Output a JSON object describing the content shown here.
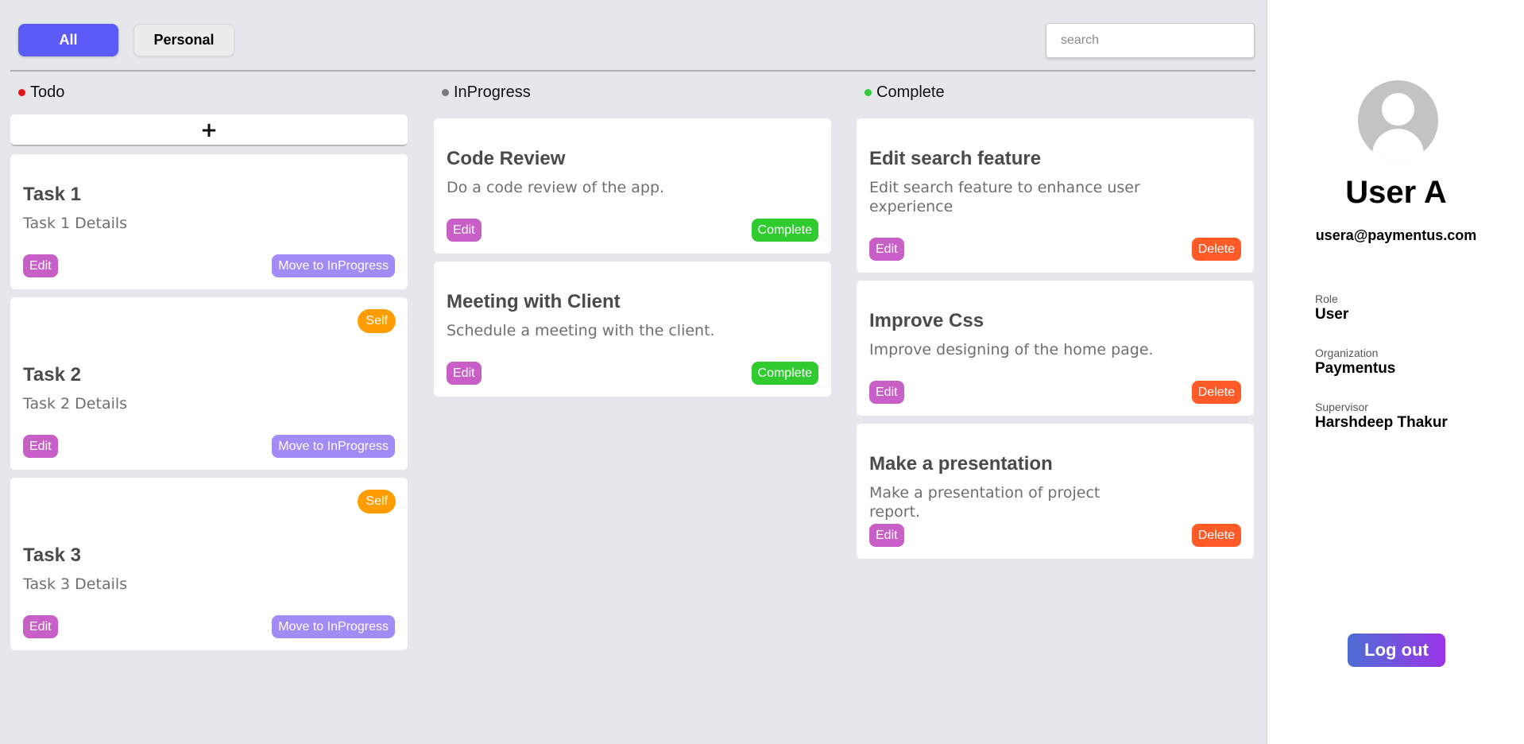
{
  "filters": {
    "all": "All",
    "personal": "Personal"
  },
  "search": {
    "placeholder": "search",
    "value": ""
  },
  "add_label": "+",
  "colors": {
    "accent": "#5b5bf7",
    "todo": "#e8131a",
    "inprogress": "#7b7b7b",
    "complete": "#32c83a",
    "edit": "#c75fc7",
    "move": "#a18cf5",
    "complete_btn": "#2fcb2f",
    "delete": "#ff5a27",
    "self": "#ff9d00"
  },
  "columns": {
    "todo": {
      "title": "Todo",
      "cards": [
        {
          "title": "Task 1",
          "desc": "Task 1 Details",
          "edit": "Edit",
          "action": "Move to InProgress"
        },
        {
          "badge": "Self",
          "title": "Task 2",
          "desc": "Task 2 Details",
          "edit": "Edit",
          "action": "Move to InProgress"
        },
        {
          "badge": "Self",
          "title": "Task 3",
          "desc": "Task 3 Details",
          "edit": "Edit",
          "action": "Move to InProgress"
        }
      ]
    },
    "inprogress": {
      "title": "InProgress",
      "cards": [
        {
          "title": "Code Review",
          "desc": "Do a code review of the app.",
          "edit": "Edit",
          "action": "Complete"
        },
        {
          "title": "Meeting with Client",
          "desc": "Schedule a meeting with the client.",
          "edit": "Edit",
          "action": "Complete"
        }
      ]
    },
    "complete": {
      "title": "Complete",
      "cards": [
        {
          "title": "Edit search feature",
          "desc": "Edit search feature to enhance user experience",
          "edit": "Edit",
          "action": "Delete"
        },
        {
          "title": "Improve Css",
          "desc": "Improve designing of the home page.",
          "edit": "Edit",
          "action": "Delete"
        },
        {
          "title": "Make a presentation",
          "desc": "Make a presentation of project report.",
          "edit": "Edit",
          "action": "Delete"
        }
      ]
    }
  },
  "profile": {
    "avatar_icon": "user-avatar-icon",
    "name": "User A",
    "email": "usera@paymentus.com",
    "role_label": "Role",
    "role": "User",
    "org_label": "Organization",
    "org": "Paymentus",
    "supervisor_label": "Supervisor",
    "supervisor": "Harshdeep Thakur",
    "logout": "Log out"
  }
}
